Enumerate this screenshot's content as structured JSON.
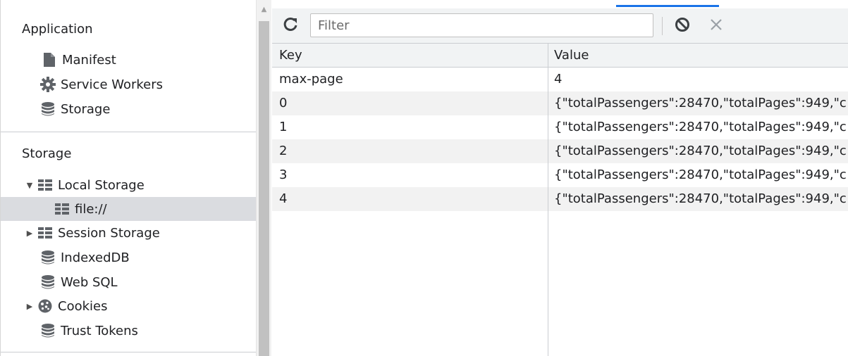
{
  "sidebar": {
    "application_title": "Application",
    "application_items": [
      {
        "label": "Manifest",
        "icon": "document-icon"
      },
      {
        "label": "Service Workers",
        "icon": "gear-icon"
      },
      {
        "label": "Storage",
        "icon": "database-icon"
      }
    ],
    "storage_title": "Storage",
    "storage_items": [
      {
        "label": "Local Storage",
        "icon": "table-icon",
        "expanded": true
      },
      {
        "label": "file://",
        "icon": "table-icon",
        "selected": true
      },
      {
        "label": "Session Storage",
        "icon": "table-icon",
        "expanded": false
      },
      {
        "label": "IndexedDB",
        "icon": "database-icon"
      },
      {
        "label": "Web SQL",
        "icon": "database-icon"
      },
      {
        "label": "Cookies",
        "icon": "cookie-icon",
        "expanded": false
      },
      {
        "label": "Trust Tokens",
        "icon": "database-icon"
      }
    ]
  },
  "toolbar": {
    "filter_placeholder": "Filter",
    "refresh_icon": "refresh-icon",
    "clear_icon": "block-icon",
    "delete_icon": "close-icon"
  },
  "table": {
    "columns": [
      "Key",
      "Value"
    ],
    "rows": [
      {
        "key": "max-page",
        "value": "4"
      },
      {
        "key": "0",
        "value": "{\"totalPassengers\":28470,\"totalPages\":949,\"c"
      },
      {
        "key": "1",
        "value": "{\"totalPassengers\":28470,\"totalPages\":949,\"c"
      },
      {
        "key": "2",
        "value": "{\"totalPassengers\":28470,\"totalPages\":949,\"c"
      },
      {
        "key": "3",
        "value": "{\"totalPassengers\":28470,\"totalPages\":949,\"c"
      },
      {
        "key": "4",
        "value": "{\"totalPassengers\":28470,\"totalPages\":949,\"c"
      }
    ]
  },
  "colors": {
    "accent": "#1a73e8",
    "selected_row": "#dadce0",
    "toolbar_bg": "#f1f3f4",
    "icon_dark": "#5f6368"
  }
}
